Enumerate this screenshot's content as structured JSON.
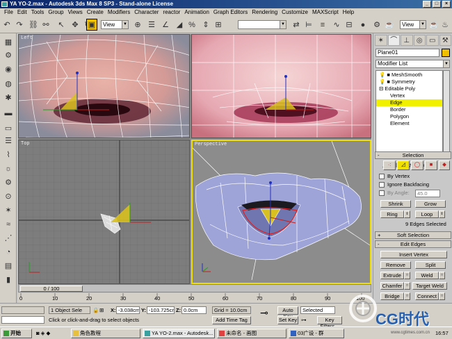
{
  "window": {
    "title": "YA YO-2.max - Autodesk 3ds Max 8 SP3 - Stand-alone License"
  },
  "menu": [
    "File",
    "Edit",
    "Tools",
    "Group",
    "Views",
    "Create",
    "Modifiers",
    "Character",
    "reactor",
    "Animation",
    "Graph Editors",
    "Rendering",
    "Customize",
    "MAXScript",
    "Help"
  ],
  "toolbar": {
    "ref_coord": "View",
    "view_dd2": "View"
  },
  "viewports": {
    "left": "Left",
    "top": "Top",
    "perspective": "Perspective"
  },
  "command_panel": {
    "object_name": "Plane01",
    "object_color": "#f0c000",
    "modifier_list": "Modifier List",
    "stack": [
      {
        "label": "MeshSmooth",
        "selected": false
      },
      {
        "label": "Symmetry",
        "selected": false
      },
      {
        "label": "Editable Poly",
        "selected": false
      },
      {
        "label": "Vertex",
        "selected": false
      },
      {
        "label": "Edge",
        "selected": true
      },
      {
        "label": "Border",
        "selected": false
      },
      {
        "label": "Polygon",
        "selected": false
      },
      {
        "label": "Element",
        "selected": false
      }
    ],
    "selection": {
      "title": "Selection",
      "by_vertex": "By Vertex",
      "ignore_backfacing": "Ignore Backfacing",
      "by_angle": "By Angle:",
      "angle_value": "45.0",
      "shrink": "Shrink",
      "grow": "Grow",
      "ring": "Ring",
      "loop": "Loop",
      "status": "9 Edges Selected"
    },
    "soft_selection": {
      "title": "Soft Selection"
    },
    "edit_edges": {
      "title": "Edit Edges",
      "insert_vertex": "Insert Vertex",
      "remove": "Remove",
      "split": "Split",
      "extrude": "Extrude",
      "weld": "Weld",
      "chamfer": "Chamfer",
      "target_weld": "Target Weld",
      "bridge": "Bridge",
      "connect": "Connect"
    }
  },
  "timeline": {
    "frame": "0 / 100",
    "ticks": [
      "0",
      "10",
      "20",
      "30",
      "40",
      "50",
      "60",
      "70",
      "80",
      "90",
      "100"
    ]
  },
  "status": {
    "selection": "1 Object Sele",
    "x": "-3.038cm",
    "y": "-103.725cr",
    "z": "0.0cm",
    "grid": "Grid = 10.0cm",
    "prompt": "Click or click-and-drag to select objects",
    "add_time_tag": "Add Time Tag",
    "auto_key": "Auto Key",
    "set_key": "Set Key",
    "key_mode": "Selected",
    "key_filters": "Key Filters..."
  },
  "taskbar": {
    "start": "开始",
    "items": [
      "角色教程",
      "YA YO-2.max - Autodesk...",
      "未命名 - 画图",
      "03广设 - 群"
    ],
    "clock": "16:57"
  },
  "watermark": {
    "brand": "CG时代",
    "url": "www.cgtimes.com.cn"
  }
}
